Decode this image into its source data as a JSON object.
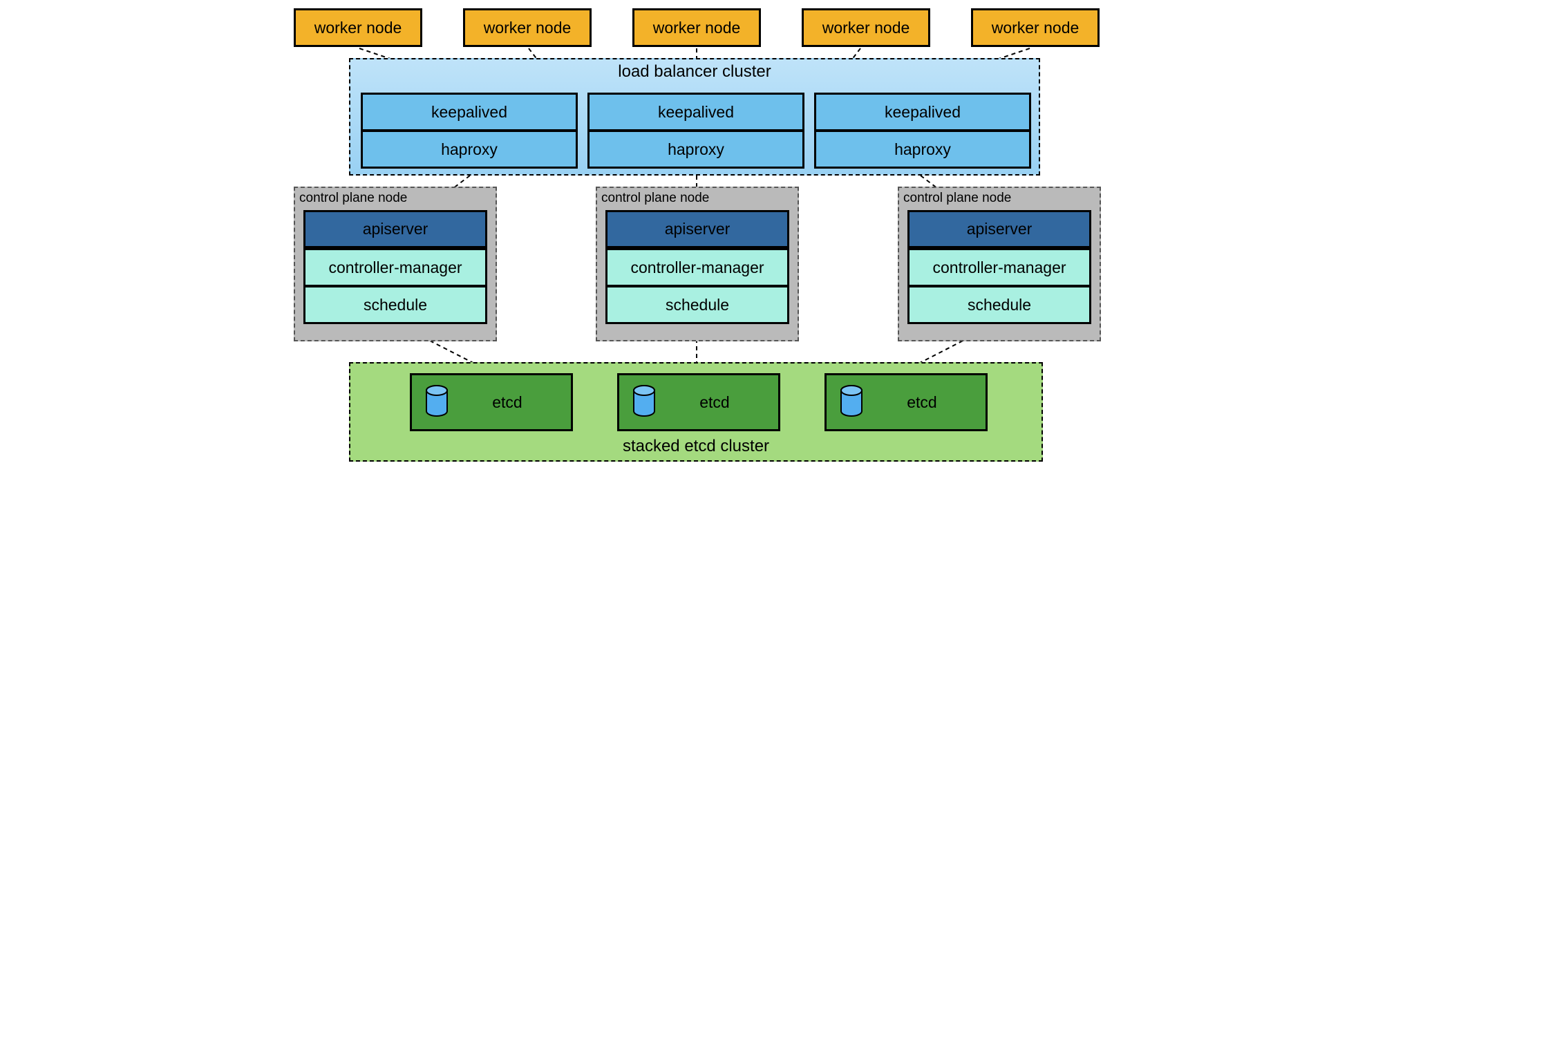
{
  "workers": {
    "label": "worker node",
    "count": 5
  },
  "load_balancer": {
    "title": "load balancer cluster",
    "nodes": [
      {
        "keepalived": "keepalived",
        "haproxy": "haproxy"
      },
      {
        "keepalived": "keepalived",
        "haproxy": "haproxy"
      },
      {
        "keepalived": "keepalived",
        "haproxy": "haproxy"
      }
    ]
  },
  "control_plane": {
    "node_label": "control plane node",
    "components": {
      "apiserver": "apiserver",
      "controller_manager": "controller-manager",
      "schedule": "schedule"
    },
    "count": 3
  },
  "etcd": {
    "cluster_title": "stacked etcd cluster",
    "label": "etcd",
    "count": 3
  },
  "colors": {
    "worker_fill": "#f3b229",
    "lb_fill": "#6ec0ec",
    "apiserver_fill": "#32689f",
    "cp_component_fill": "#a9f0e1",
    "cp_node_fill": "#bababa",
    "etcd_cluster_fill": "#a4da7f",
    "etcd_box_fill": "#4a9e3d",
    "db_icon_fill": "#53aef0"
  }
}
